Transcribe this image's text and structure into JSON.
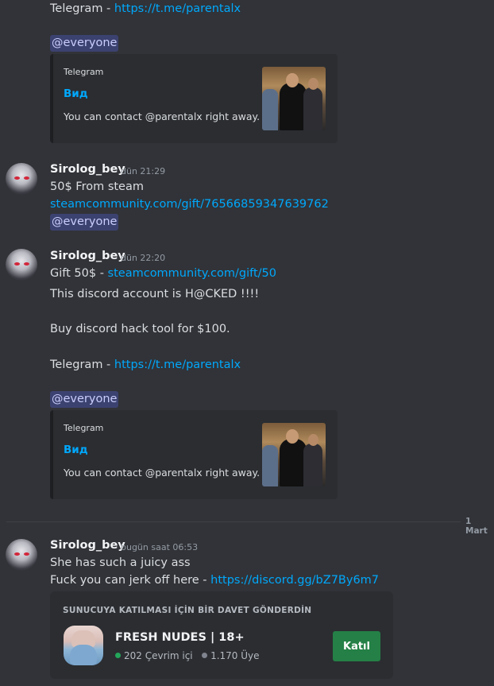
{
  "msg0": {
    "telegram_prefix": "Telegram - ",
    "telegram_link": "https://t.me/parentalx",
    "mention": "@everyone",
    "embed": {
      "provider": "Telegram",
      "title": "Вид",
      "description": "You can contact @parentalx right away."
    }
  },
  "msg1": {
    "username": "Sirolog_bey",
    "timestamp": "dün 21:29",
    "line1": "50$ From steam",
    "link": "steamcommunity.com/gift/76566859347639762",
    "mention": "@everyone"
  },
  "msg2": {
    "username": "Sirolog_bey",
    "timestamp": "dün 22:20",
    "gift_prefix": "Gift 50$ - ",
    "gift_link": "steamcommunity.com/gift/50",
    "line2": "This discord account is H@CKED !!!!",
    "line3": "Buy discord hack tool for $100.",
    "telegram_prefix": "Telegram - ",
    "telegram_link": "https://t.me/parentalx",
    "mention": "@everyone",
    "embed": {
      "provider": "Telegram",
      "title": "Вид",
      "description": "You can contact @parentalx right away."
    }
  },
  "divider": {
    "label": "1 Mart"
  },
  "msg3": {
    "username": "Sirolog_bey",
    "timestamp": "bugün saat 06:53",
    "line1": "She has such a juicy ass",
    "line2_prefix": "Fuck you can jerk off here - ",
    "line2_link": "https://discord.gg/bZ7By6m7",
    "invite": {
      "heading": "SUNUCUYA KATILMASI İÇİN BİR DAVET GÖNDERDİN",
      "server_name": "FRESH NUDES | 18+",
      "online": "202 Çevrim içi",
      "members": "1.170 Üye",
      "join_label": "Katıl"
    }
  },
  "colors": {
    "background": "#313338",
    "link": "#00a8fc",
    "mention_bg": "#3c4270",
    "join_button": "#248046",
    "online_dot": "#23a55a",
    "member_dot": "#80848e"
  }
}
